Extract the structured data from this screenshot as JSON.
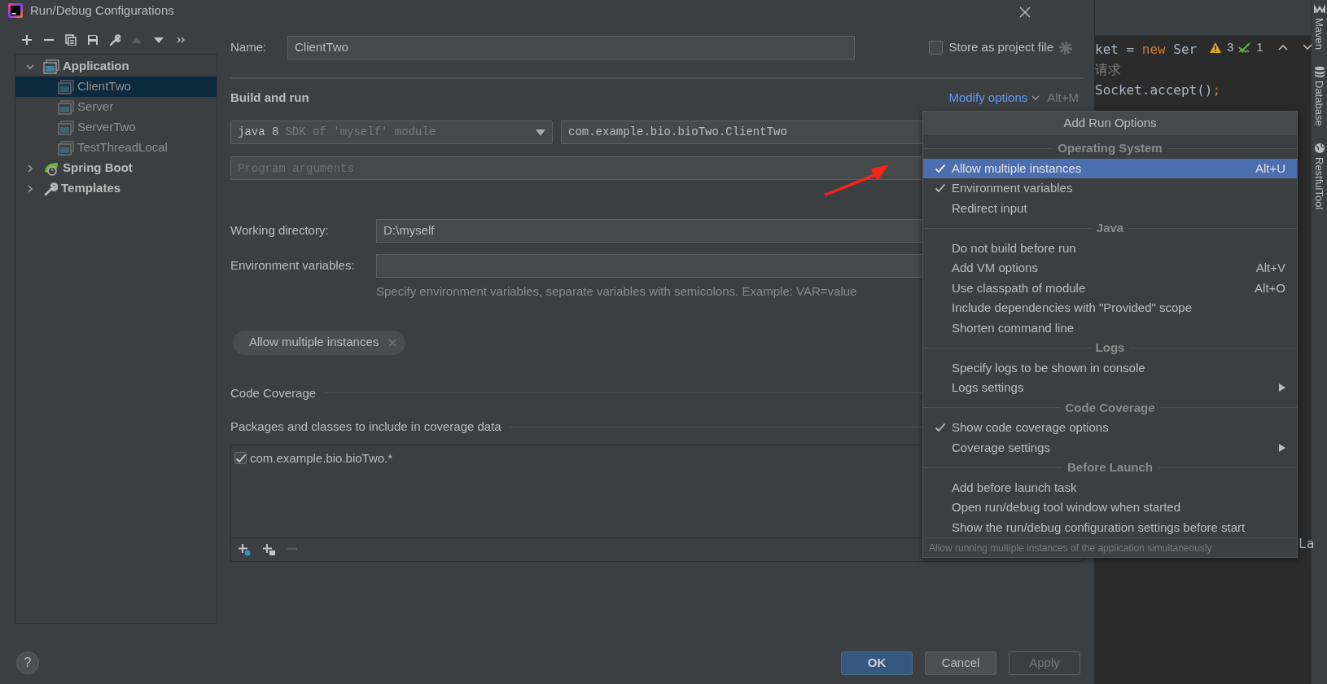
{
  "window": {
    "title": "Run/Debug Configurations"
  },
  "toolbar": [
    {
      "kind": "add",
      "disabled": false
    },
    {
      "kind": "remove",
      "disabled": false
    },
    {
      "kind": "copy",
      "disabled": false
    },
    {
      "kind": "save",
      "disabled": false
    },
    {
      "kind": "wrench",
      "disabled": false
    },
    {
      "kind": "move-up",
      "disabled": true
    },
    {
      "kind": "move-down",
      "disabled": false
    },
    {
      "kind": "more",
      "disabled": false
    }
  ],
  "tree": [
    {
      "label": "Application",
      "kind": "application",
      "expanded": true,
      "selected": false,
      "children": [
        {
          "label": "ClientTwo",
          "kind": "config",
          "selected": true
        },
        {
          "label": "Server",
          "kind": "config",
          "selected": false
        },
        {
          "label": "ServerTwo",
          "kind": "config",
          "selected": false
        },
        {
          "label": "TestThreadLocal",
          "kind": "config",
          "selected": false
        }
      ]
    },
    {
      "label": "Spring Boot",
      "kind": "spring",
      "expanded": false,
      "selected": false
    },
    {
      "label": "Templates",
      "kind": "templates",
      "expanded": false,
      "selected": false
    }
  ],
  "name": {
    "label": "Name:",
    "value": "ClientTwo"
  },
  "store_as_project_file": {
    "label": "Store as project file",
    "checked": false
  },
  "build_and_run": {
    "title": "Build and run",
    "modify_options": "Modify options",
    "shortcut": "Alt+M",
    "jre": {
      "value": "java 8",
      "hint": "SDK of 'myself' module"
    },
    "main_class": "com.example.bio.bioTwo.ClientTwo",
    "program_arguments": {
      "placeholder": "Program arguments"
    }
  },
  "working_directory": {
    "label": "Working directory:",
    "value": "D:\\myself"
  },
  "environment_variables": {
    "label": "Environment variables:",
    "hint": "Specify environment variables, separate variables with semicolons. Example: VAR=value"
  },
  "option_chips": [
    {
      "label": "Allow multiple instances"
    }
  ],
  "code_coverage": {
    "title": "Code Coverage",
    "packages_title": "Packages and classes to include in coverage data",
    "patterns": [
      {
        "label": "com.example.bio.bioTwo.*",
        "checked": true
      }
    ],
    "toolbar": [
      {
        "kind": "add-class",
        "disabled": false
      },
      {
        "kind": "add-package",
        "disabled": false
      },
      {
        "kind": "remove",
        "disabled": true
      }
    ]
  },
  "help": "?",
  "footer_buttons": [
    {
      "label": "OK",
      "kind": "primary",
      "disabled": false
    },
    {
      "label": "Cancel",
      "kind": "default",
      "disabled": false
    },
    {
      "label": "Apply",
      "kind": "default",
      "disabled": true
    }
  ],
  "popup": {
    "title": "Add Run Options",
    "sections": [
      {
        "title": "Operating System",
        "items": [
          {
            "label": "Allow multiple instances",
            "shortcut": "Alt+U",
            "checked": true,
            "selected": true,
            "submenu": false
          },
          {
            "label": "Environment variables",
            "checked": true,
            "selected": false,
            "submenu": false
          },
          {
            "label": "Redirect input",
            "checked": false,
            "selected": false,
            "submenu": false
          }
        ]
      },
      {
        "title": "Java",
        "items": [
          {
            "label": "Do not build before run",
            "checked": false,
            "selected": false,
            "submenu": false
          },
          {
            "label": "Add VM options",
            "shortcut": "Alt+V",
            "checked": false,
            "selected": false,
            "submenu": false
          },
          {
            "label": "Use classpath of module",
            "shortcut": "Alt+O",
            "checked": false,
            "selected": false,
            "submenu": false
          },
          {
            "label": "Include dependencies with \"Provided\" scope",
            "checked": false,
            "selected": false,
            "submenu": false
          },
          {
            "label": "Shorten command line",
            "checked": false,
            "selected": false,
            "submenu": false
          }
        ]
      },
      {
        "title": "Logs",
        "items": [
          {
            "label": "Specify logs to be shown in console",
            "checked": false,
            "selected": false,
            "submenu": false
          },
          {
            "label": "Logs settings",
            "checked": false,
            "selected": false,
            "submenu": true
          }
        ]
      },
      {
        "title": "Code Coverage",
        "items": [
          {
            "label": "Show code coverage options",
            "checked": true,
            "selected": false,
            "submenu": false
          },
          {
            "label": "Coverage settings",
            "checked": false,
            "selected": false,
            "submenu": true
          }
        ]
      },
      {
        "title": "Before Launch",
        "items": [
          {
            "label": "Add before launch task",
            "checked": false,
            "selected": false,
            "submenu": false
          },
          {
            "label": "Open run/debug tool window when started",
            "checked": false,
            "selected": false,
            "submenu": false
          },
          {
            "label": "Show the run/debug configuration settings before start",
            "checked": false,
            "selected": false,
            "submenu": false
          }
        ]
      }
    ],
    "footer": "Allow running multiple instances of the application simultaneously"
  },
  "editor": {
    "lines": [
      {
        "tokens": [
          {
            "text": "ket = ",
            "kind": "plain"
          },
          {
            "text": "new",
            "kind": "keyword"
          },
          {
            "text": " Ser",
            "kind": "plain"
          }
        ]
      },
      {
        "tokens": [
          {
            "text": "请求",
            "kind": "comment"
          }
        ]
      },
      {
        "tokens": [
          {
            "text": "Socket.accept()",
            "kind": "plain"
          },
          {
            "text": ";",
            "kind": "keyword"
          }
        ]
      }
    ],
    "warnings": "3",
    "weak_warnings": "1",
    "bottom_fragment": "La"
  },
  "tool_strip": [
    {
      "label": "Maven",
      "kind": "maven"
    },
    {
      "label": "Database",
      "kind": "database"
    },
    {
      "label": "RestfulTool",
      "kind": "restful"
    }
  ]
}
